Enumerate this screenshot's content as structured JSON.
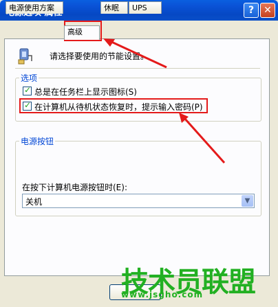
{
  "window": {
    "title": "电源选项 属性",
    "help_label": "?",
    "close_label": "✕"
  },
  "tabs": [
    {
      "label": "电源使用方案"
    },
    {
      "label": "高级"
    },
    {
      "label": "休眠"
    },
    {
      "label": "UPS"
    }
  ],
  "intro_text": "请选择要使用的节能设置。",
  "options_group": {
    "label": "选项",
    "checkbox1": "总是在任务栏上显示图标(S)",
    "checkbox2": "在计算机从待机状态恢复时，提示输入密码(P)"
  },
  "power_buttons_group": {
    "label": "电源按钮",
    "combo_label": "在按下计算机电源按钮时(E):",
    "combo_value": "关机",
    "combo_icon": "chevron-down-icon"
  },
  "watermark": {
    "text": "技术员联盟",
    "url": "www.jsgho.com"
  },
  "colors": {
    "accent": "#0046d5",
    "highlight": "#e41a1a",
    "watermark": "#22b022"
  }
}
